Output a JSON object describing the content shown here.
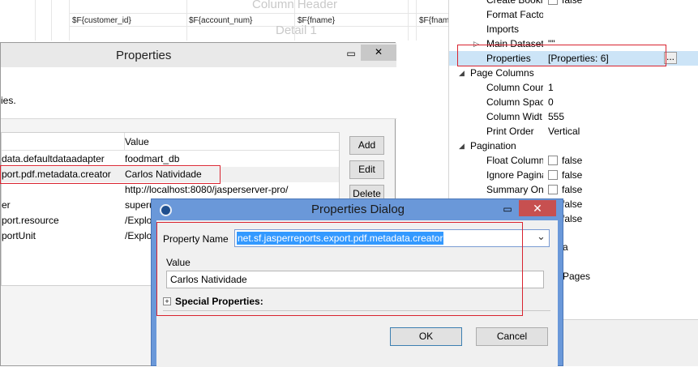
{
  "report": {
    "column_header": "Column Header",
    "detail": "Detail 1",
    "fields": [
      "$F{customer_id}",
      "$F{account_num}",
      "$F{fname}",
      "$F{fname"
    ]
  },
  "right_panel": {
    "rows": [
      {
        "type": "prop",
        "name": "Create Bookm",
        "value": "false",
        "checkbox": true
      },
      {
        "type": "prop",
        "name": "Format Facto",
        "value": ""
      },
      {
        "type": "prop",
        "name": "Imports",
        "value": ""
      },
      {
        "type": "prop",
        "name": "Main Dataset",
        "value": "\"\"",
        "expander": "▷"
      },
      {
        "type": "prop",
        "name": "Properties",
        "value": "[Properties: 6]",
        "selected": true,
        "ellipsis": "..."
      },
      {
        "type": "cat",
        "name": "Page Columns",
        "expander": "◢"
      },
      {
        "type": "prop",
        "name": "Column Cour",
        "value": "1"
      },
      {
        "type": "prop",
        "name": "Column Spac",
        "value": "0"
      },
      {
        "type": "prop",
        "name": "Column Widt",
        "value": "555"
      },
      {
        "type": "prop",
        "name": "Print Order",
        "value": "Vertical"
      },
      {
        "type": "cat",
        "name": "Pagination",
        "expander": "◢"
      },
      {
        "type": "prop",
        "name": "Float Column",
        "value": "false",
        "checkbox": true
      },
      {
        "type": "prop",
        "name": "Ignore Pagina",
        "value": "false",
        "checkbox": true
      },
      {
        "type": "prop",
        "name": "Summary On",
        "value": "false",
        "checkbox": true
      },
      {
        "type": "prop",
        "name": "",
        "value": "false",
        "checkbox": true
      },
      {
        "type": "prop",
        "name": "",
        "value": "false",
        "checkbox": true
      }
    ],
    "partial_values": [
      "a",
      "Pages"
    ]
  },
  "properties_window": {
    "title": "Properties",
    "description": "ies.",
    "value_header": "Value",
    "rows": [
      {
        "key": "data.defaultdataadapter",
        "value": "foodmart_db"
      },
      {
        "key": "port.pdf.metadata.creator",
        "value": "Carlos Natividade"
      },
      {
        "key": "",
        "value": "http://localhost:8080/jasperserver-pro/"
      },
      {
        "key": "er",
        "value": "superu"
      },
      {
        "key": "port.resource",
        "value": "/Explor"
      },
      {
        "key": "portUnit",
        "value": "/Explor"
      }
    ],
    "buttons": {
      "add": "Add",
      "edit": "Edit",
      "delete": "Delete"
    },
    "minimize": "▭",
    "close": "✕"
  },
  "dialog": {
    "title": "Properties Dialog",
    "property_name_label": "Property Name",
    "property_name_value": "net.sf.jasperreports.export.pdf.metadata.creator",
    "value_label": "Value",
    "value_text": "Carlos Natividade",
    "special_properties": "Special Properties:",
    "expand_glyph": "+",
    "ok": "OK",
    "cancel": "Cancel",
    "minimize": "▭",
    "close": "✕",
    "dropdown_glyph": "⌄"
  },
  "colors": {
    "title_bar": "#6a98d9",
    "highlight_red": "#d9232f",
    "selection_blue": "#3399ff"
  }
}
